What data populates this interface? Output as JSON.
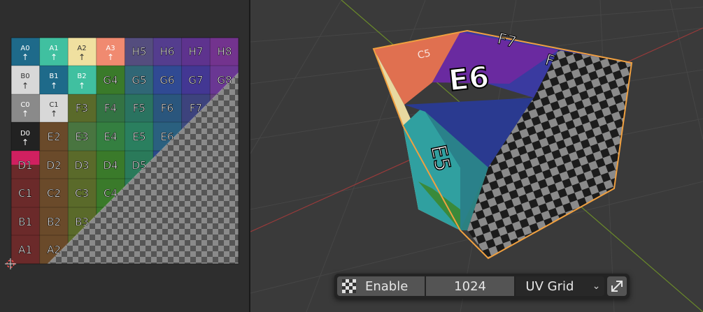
{
  "uv_editor": {
    "top_row_labels": [
      "A0",
      "A1",
      "A2",
      "A3"
    ],
    "row_b_labels": [
      "B0",
      "B1",
      "B2"
    ],
    "row_c_labels": [
      "C0",
      "C1"
    ],
    "row_d_labels": [
      "D0"
    ],
    "arrow": "↑",
    "big_labels": [
      "H5",
      "H6",
      "H7",
      "H8",
      "G4",
      "G5",
      "G6",
      "G7",
      "G8",
      "F3",
      "F4",
      "F5",
      "F6",
      "F7",
      "E2",
      "E3",
      "E4",
      "E5",
      "E6",
      "D1",
      "D2",
      "D3",
      "D4",
      "D5",
      "C1",
      "C2",
      "C3",
      "C4",
      "B1",
      "B2",
      "B3",
      "A1",
      "A2"
    ]
  },
  "viewport": {
    "cube_top_labels": [
      "C5",
      "F7",
      "F"
    ],
    "cube_big_label": "E6",
    "cube_side_label": "E5"
  },
  "toolbar": {
    "enable_label": "Enable",
    "resolution_value": "1024",
    "type_value": "UV Grid",
    "checker_icon": "checker-icon",
    "sync_icon": "sync-arrows-icon",
    "chevron_icon": "chevron-down-icon"
  },
  "colors": {
    "accent_orange": "#f0a040",
    "panel_bg": "#2e2e2e",
    "viewport_bg": "#3a3a3a"
  }
}
